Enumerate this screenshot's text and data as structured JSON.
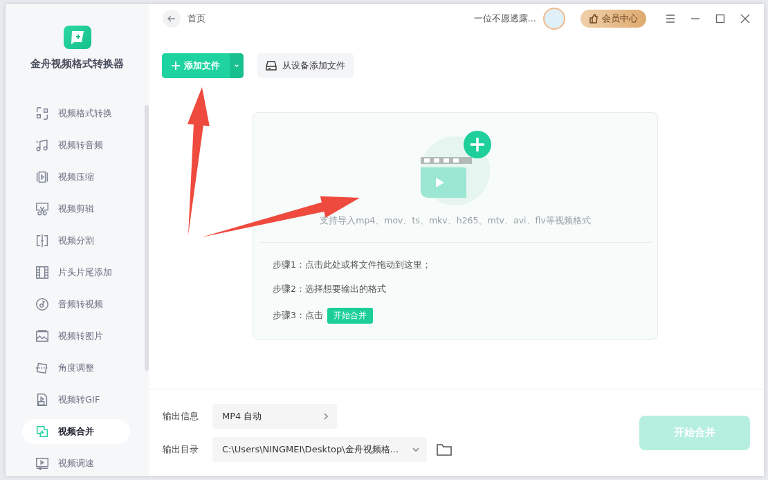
{
  "app": {
    "name": "金舟视频格式转换器"
  },
  "sidebar": {
    "items": [
      {
        "label": "视频格式转换",
        "selected": false
      },
      {
        "label": "视频转音频",
        "selected": false
      },
      {
        "label": "视频压缩",
        "selected": false
      },
      {
        "label": "视频剪辑",
        "selected": false
      },
      {
        "label": "视频分割",
        "selected": false
      },
      {
        "label": "片头片尾添加",
        "selected": false
      },
      {
        "label": "音频转视频",
        "selected": false
      },
      {
        "label": "视频转图片",
        "selected": false
      },
      {
        "label": "角度调整",
        "selected": false
      },
      {
        "label": "视频转GIF",
        "selected": false
      },
      {
        "label": "视频合并",
        "selected": true
      },
      {
        "label": "视频调速",
        "selected": false
      }
    ]
  },
  "header": {
    "breadcrumb": "首页",
    "user_name": "一位不愿透露...",
    "vip_button": "会员中心"
  },
  "toolbar": {
    "add_button": "添加文件",
    "device_button": "从设备添加文件"
  },
  "drop_zone": {
    "formats": "支持导入mp4、mov、ts、mkv、h265、mtv、avi、flv等视频格式",
    "step1": "步骤1：点击此处或将文件拖动到这里；",
    "step2": "步骤2：选择想要输出的格式",
    "step3": "步骤3：点击",
    "step3_tag": "开始合并"
  },
  "output": {
    "info_label": "输出信息",
    "info_value": "MP4 自动",
    "dir_label": "输出目录",
    "dir_value": "C:\\Users\\NINGMEI\\Desktop\\金舟视频格...",
    "start_button": {
      "label": "开始合并",
      "disabled": true
    }
  }
}
